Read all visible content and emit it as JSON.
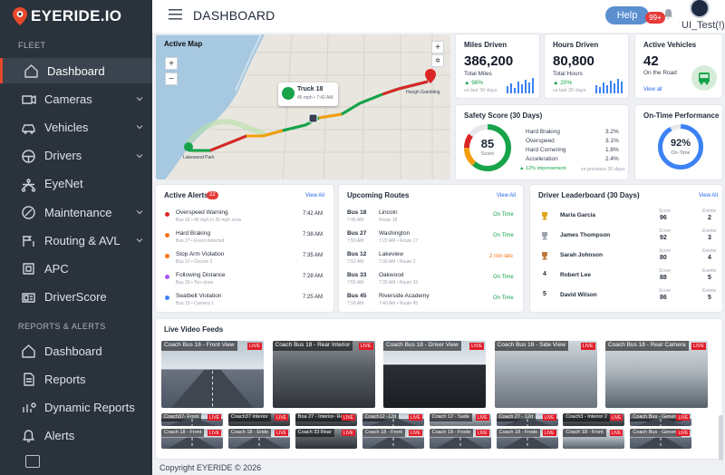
{
  "brand": {
    "name": "EYERIDE.IO",
    "accent": "#e8482a",
    "sidebar_bg": "#2a323c"
  },
  "sidebar": {
    "fleet_label": "FLEET",
    "reports_label": "REPORTS & ALERTS",
    "fleet_items": [
      {
        "label": "Dashboard",
        "icon": "home-icon",
        "active": true
      },
      {
        "label": "Cameras",
        "icon": "camera-icon"
      },
      {
        "label": "Vehicles",
        "icon": "car-icon"
      },
      {
        "label": "Drivers",
        "icon": "steering-wheel-icon"
      },
      {
        "label": "EyeNet",
        "icon": "network-icon"
      },
      {
        "label": "Maintenance",
        "icon": "wrench-icon"
      },
      {
        "label": "Routing & AVL",
        "icon": "route-icon"
      },
      {
        "label": "APC",
        "icon": "apc-icon"
      },
      {
        "label": "DriverScore",
        "icon": "id-card-icon"
      }
    ],
    "report_items": [
      {
        "label": "Dashboard",
        "icon": "home-icon"
      },
      {
        "label": "Reports",
        "icon": "document-icon"
      },
      {
        "label": "Dynamic Reports",
        "icon": "chart-gear-icon"
      },
      {
        "label": "Alerts",
        "icon": "bell-icon"
      }
    ]
  },
  "header": {
    "title": "DASHBOARD",
    "help": "Help",
    "notif_badge": "99+",
    "user": "UI_Test(!)"
  },
  "map": {
    "title": "Active Map",
    "zoom_in": "+",
    "zoom_out": "−",
    "truck_name": "Truck 18",
    "truck_info": "45 mph  •  7:42 AM",
    "destination": "Hoogh Gambling",
    "origin": "Lakewood Park"
  },
  "stats": {
    "miles": {
      "title": "Miles Driven",
      "value": "386,200",
      "label": "Total Miles",
      "change": "▲ 98%",
      "note": "vs last 30 days"
    },
    "hours": {
      "title": "Hours Driven",
      "value": "80,800",
      "label": "Total Hours",
      "change": "▲ 20%",
      "note": "vs last 30 days"
    },
    "vehicles": {
      "title": "Active Vehicles",
      "value": "42",
      "label": "On the Road",
      "link": "View all"
    }
  },
  "safety": {
    "title": "Safety Score (30 Days)",
    "score": "85",
    "score_label": "Score",
    "score_value": 85,
    "rows": [
      {
        "k": "Hard Braking",
        "v": "3.2%"
      },
      {
        "k": "Overspeed",
        "v": "3.1%"
      },
      {
        "k": "Hard Cornering",
        "v": "1.8%"
      },
      {
        "k": "Acceleration",
        "v": "2.4%"
      }
    ],
    "improvement": "▲ 12% improvement",
    "note": "vs previous 30 days"
  },
  "ontime": {
    "title": "On-Time Performance",
    "value": "92%",
    "label": "On-Time",
    "fraction": 0.92
  },
  "alerts": {
    "title": "Active Alerts",
    "count": "22",
    "link": "View All",
    "items": [
      {
        "name": "Overspeed Warning",
        "sub": "Bus 18  •  45 mph in 35 mph zone",
        "time": "7:42 AM",
        "color": "#dc2626"
      },
      {
        "name": "Hard Braking",
        "sub": "Bus 27  •  Event detected",
        "time": "7:38 AM",
        "color": "#f97316"
      },
      {
        "name": "Stop Arm Violation",
        "sub": "Bus 12  •  Oscore 2",
        "time": "7:35 AM",
        "color": "#f97316"
      },
      {
        "name": "Following Distance",
        "sub": "Bus 33  •  Too close",
        "time": "7:28 AM",
        "color": "#a855f7"
      },
      {
        "name": "Seatbelt Violation",
        "sub": "Bus 19  •  Camera 1",
        "time": "7:25 AM",
        "color": "#3b82f6"
      }
    ]
  },
  "routes": {
    "title": "Upcoming Routes",
    "link": "View All",
    "items": [
      {
        "bus": "Bus 18",
        "time": "7:45 AM",
        "stop": "Lincoln",
        "route": "Route 18",
        "status": "On Time",
        "late": false
      },
      {
        "bus": "Bus 27",
        "time": "7:50 AM",
        "stop": "Washington",
        "route": "7:22 AM  •  Route 17",
        "status": "On Time",
        "late": false
      },
      {
        "bus": "Bus 12",
        "time": "7:52 AM",
        "stop": "Lakeview",
        "route": "7:30 AM  •  Route 2",
        "status": "2 min late",
        "late": true
      },
      {
        "bus": "Bus 33",
        "time": "7:55 AM",
        "stop": "Oakwood",
        "route": "7:35 AM  •  Route 33",
        "status": "On Time",
        "late": false
      },
      {
        "bus": "Bus 45",
        "time": "7:58 AM",
        "stop": "Riverside Academy",
        "route": "7:40 AM  •  Route 45",
        "status": "On Time",
        "late": false
      }
    ]
  },
  "leaderboard": {
    "title": "Driver Leaderboard (30 Days)",
    "link": "View All",
    "score_label": "Score",
    "events_label": "Events",
    "items": [
      {
        "rank": "1",
        "name": "Maria Garcia",
        "score": "96",
        "events": "2",
        "medal": "#e0a21b"
      },
      {
        "rank": "2",
        "name": "James Thompson",
        "score": "92",
        "events": "3",
        "medal": "#9ca3af"
      },
      {
        "rank": "3",
        "name": "Sarah Johnson",
        "score": "80",
        "events": "4",
        "medal": "#c2773a"
      },
      {
        "rank": "4",
        "name": "Robert Lee",
        "score": "88",
        "events": "5",
        "medal": ""
      },
      {
        "rank": "5",
        "name": "David Wilson",
        "score": "86",
        "events": "5",
        "medal": ""
      }
    ]
  },
  "feeds": {
    "title": "Live Video Feeds",
    "live": "LIVE",
    "main": [
      {
        "label": "Coach Bus 18 - Front View",
        "scene": "road"
      },
      {
        "label": "Coach Bus 18 - Rear Interior",
        "scene": "interior"
      },
      {
        "label": "Coach Bus 18 - Driver View",
        "scene": "cockpit"
      },
      {
        "label": "Coach Bus 18 - Side View",
        "scene": "side"
      },
      {
        "label": "Coach Bus 18 - Rear Camera",
        "scene": "rear"
      }
    ],
    "thumbs": [
      {
        "label": "Coach37- Front",
        "scene": "road"
      },
      {
        "label": "Coach37 Interior",
        "scene": "interior"
      },
      {
        "label": "Boa 27 - Interior- Rear",
        "scene": "interior"
      },
      {
        "label": "Coach12 -12d",
        "scene": "road"
      },
      {
        "label": "Coach 12 - Sade",
        "scene": "side"
      },
      {
        "label": "Coach 27 - 12d",
        "scene": "road"
      },
      {
        "label": "Coach3 - Interior 2",
        "scene": "interior"
      },
      {
        "label": "Coach Bus - Generic",
        "scene": "road"
      }
    ],
    "thumbs_bottom": [
      {
        "label": "Coach 18 - Front",
        "scene": "road"
      },
      {
        "label": "Coach 18 - Eride",
        "scene": "road"
      },
      {
        "label": "Coach 33 Rear",
        "scene": "interior"
      },
      {
        "label": "Coach 18 - Front",
        "scene": "road"
      },
      {
        "label": "Coach 18 - Frode",
        "scene": "road"
      },
      {
        "label": "Coach 18 - Frode",
        "scene": "road"
      },
      {
        "label": "Coach 18 - Front",
        "scene": "rear"
      },
      {
        "label": "Coach Bus - Generic",
        "scene": "road"
      }
    ]
  },
  "footer": "Copyright EYERIDE © 2026"
}
